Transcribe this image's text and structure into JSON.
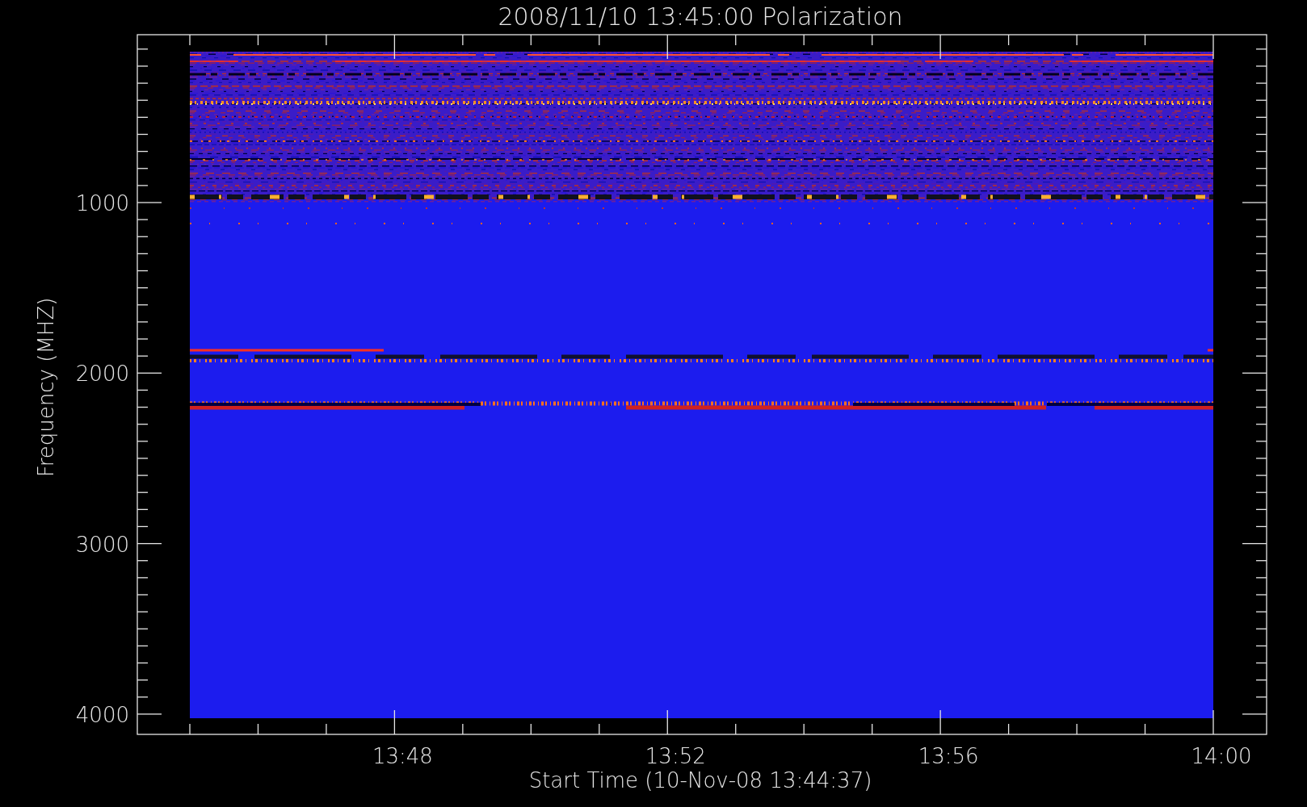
{
  "title": "2008/11/10 13:45:00 Polarization",
  "y_axis": {
    "label": "Frequency (MHZ)",
    "ticks": [
      "1000",
      "2000",
      "3000",
      "4000"
    ]
  },
  "x_axis": {
    "label": "Start Time (10-Nov-08 13:44:37)",
    "ticks": [
      "13:48",
      "13:52",
      "13:56",
      "14:00"
    ]
  }
}
